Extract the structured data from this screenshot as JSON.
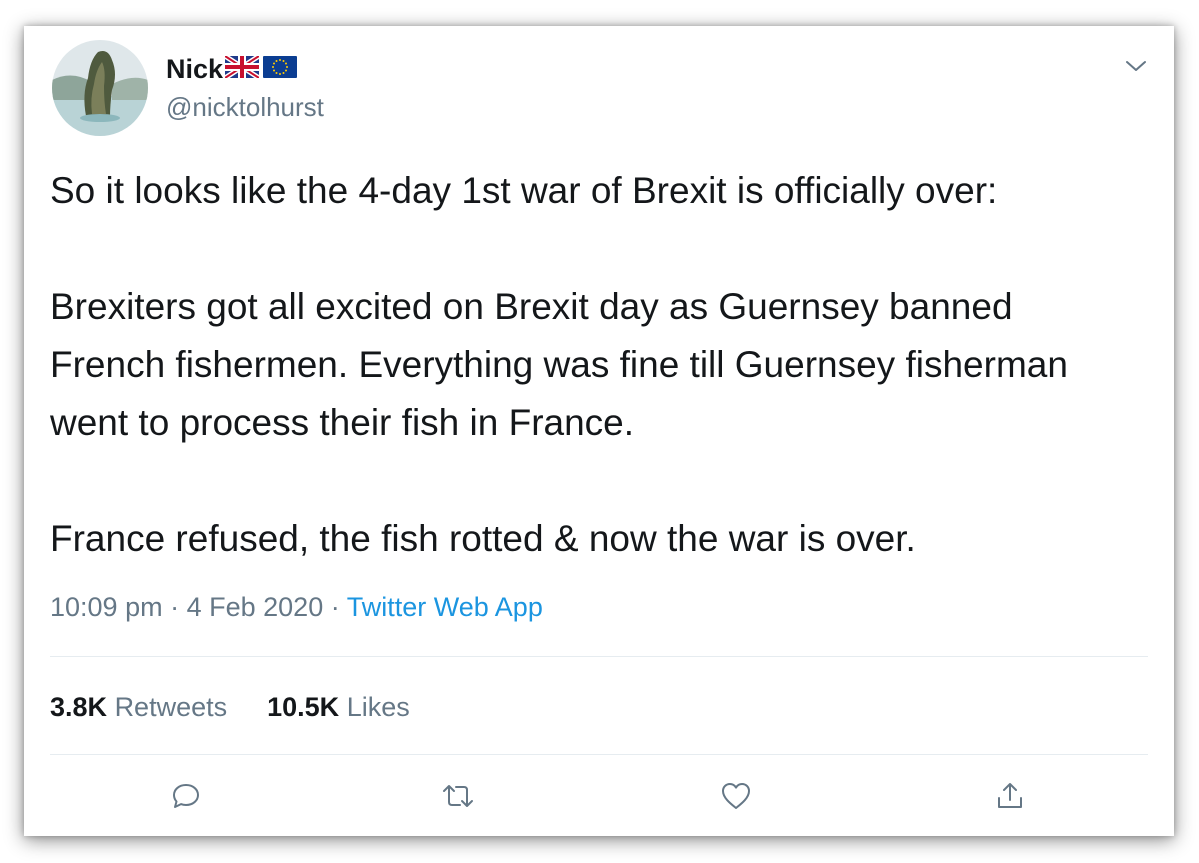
{
  "user": {
    "name": "Nick",
    "handle": "@nicktolhurst",
    "flags": [
      "uk-flag-icon",
      "eu-flag-icon"
    ]
  },
  "tweet": {
    "paragraphs": [
      "So it looks like the 4-day 1st war of Brexit is officially over:",
      "Brexiters got all excited on Brexit day as Guernsey banned French fishermen. Everything was fine till Guernsey fisherman went to process their fish in France.",
      "France refused, the fish rotted & now the war is over."
    ],
    "time": "10:09 pm",
    "date": "4 Feb 2020",
    "source": "Twitter Web App",
    "separator": "·"
  },
  "stats": {
    "retweets_count": "3.8K",
    "retweets_label": "Retweets",
    "likes_count": "10.5K",
    "likes_label": "Likes"
  },
  "icons": {
    "menu": "chevron-down-icon",
    "reply": "reply-icon",
    "retweet": "retweet-icon",
    "like": "heart-icon",
    "share": "share-icon"
  },
  "colors": {
    "text": "#14171a",
    "secondary": "#657786",
    "link": "#1b95e0",
    "divider": "#e6ecf0"
  }
}
